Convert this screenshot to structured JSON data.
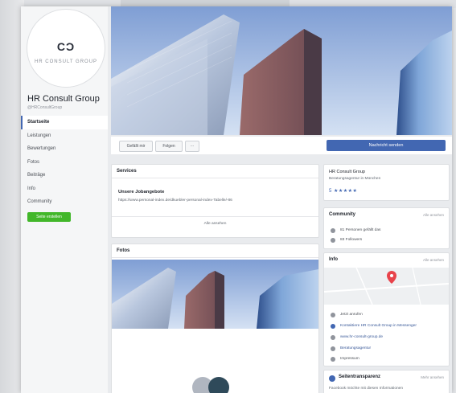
{
  "colors": {
    "facebook_blue": "#4267b2",
    "create_green": "#42b72a",
    "map_pin": "#e8434b"
  },
  "sidebar": {
    "logo_mark": "CƆ",
    "logo_sub": "HR CONSULT GROUP",
    "page_name": "HR Consult Group",
    "page_handle": "@HRConsultGroup",
    "items": [
      {
        "label": "Startseite",
        "active": true
      },
      {
        "label": "Leistungen"
      },
      {
        "label": "Bewertungen"
      },
      {
        "label": "Fotos"
      },
      {
        "label": "Beiträge"
      },
      {
        "label": "Info"
      },
      {
        "label": "Community"
      }
    ],
    "create_button": "Seite erstellen"
  },
  "actions": {
    "liked": "Gefällt mir",
    "follow": "Folgen",
    "more": "···",
    "contact": "Nachricht senden"
  },
  "services": {
    "title": "Services",
    "item_title": "Unsere Jobangebote",
    "item_text": "https://www.personal-index.de/dkuebler-personal-index-Tabelle/-86",
    "see_all": "Alle ansehen"
  },
  "photos": {
    "title": "Fotos"
  },
  "info_card": {
    "name": "HR Consult Group",
    "category": "Beratungsagentur in München",
    "rating": "5 ★★★★★"
  },
  "community": {
    "title": "Community",
    "see_all": "Alle ansehen",
    "likes": "81 Personen gefällt das",
    "followers": "83 Followers"
  },
  "info": {
    "title": "Info",
    "see_all": "Alle ansehen",
    "rows": [
      "Jetzt anrufen",
      "Kontaktiere HR Consult Group in Messenger",
      "www.hr-consult-group.de",
      "Beratungsagentur",
      "Impressum"
    ]
  },
  "transparency": {
    "title": "Seitentransparenz",
    "see_all": "Mehr ansehen",
    "text": "Facebook möchte mit diesen Informationen"
  }
}
